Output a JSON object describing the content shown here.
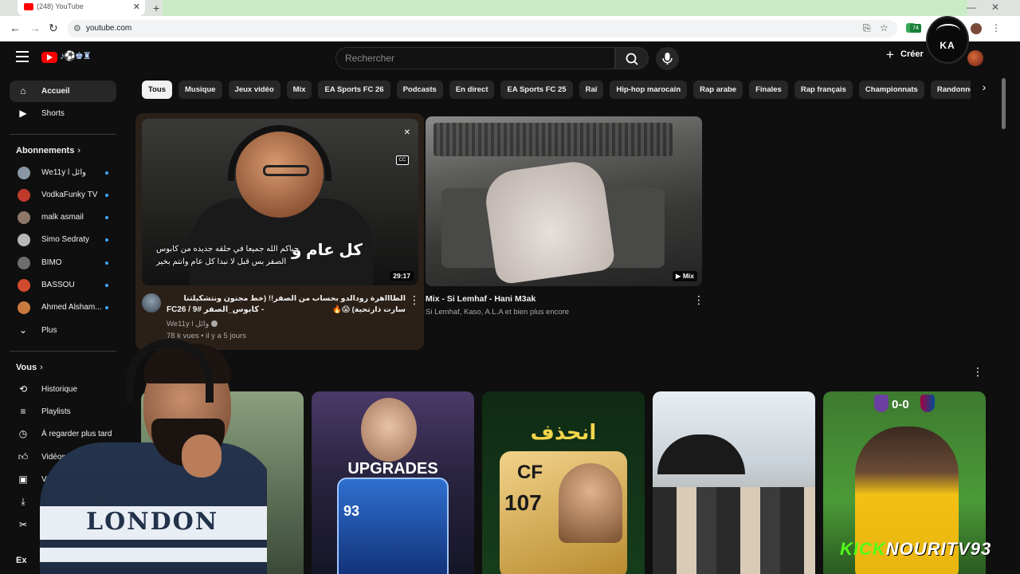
{
  "browser": {
    "tab_title": "(248) YouTube",
    "url": "youtube.com",
    "extension_badge": "74"
  },
  "header": {
    "search_placeholder": "Rechercher",
    "create_label": "Créer",
    "channel_badge_text": "KA"
  },
  "sidebar": {
    "main": [
      {
        "label": "Accueil",
        "icon": "home-icon",
        "active": true
      },
      {
        "label": "Shorts",
        "icon": "shorts-icon",
        "active": false
      }
    ],
    "subscriptions_heading": "Abonnements",
    "subscriptions": [
      {
        "label": "We11y l وائل",
        "avatar_color": "#8a96a3"
      },
      {
        "label": "VodkaFunky TV",
        "avatar_color": "#c0392b"
      },
      {
        "label": "malk asmail",
        "avatar_color": "#8e7766"
      },
      {
        "label": "Simo Sedraty",
        "avatar_color": "#b7b7b7"
      },
      {
        "label": "BIMO",
        "avatar_color": "#6d6d6d"
      },
      {
        "label": "BASSOU",
        "avatar_color": "#d24a2d"
      },
      {
        "label": "Ahmed Alsham...",
        "avatar_color": "#c87a3e"
      }
    ],
    "more_label": "Plus",
    "you_heading": "Vous",
    "you_items": [
      {
        "label": "Historique",
        "icon": "history-icon"
      },
      {
        "label": "Playlists",
        "icon": "playlists-icon"
      },
      {
        "label": "À regarder plus tard",
        "icon": "watch-later-icon"
      },
      {
        "label": "Vidéos \"J'",
        "icon": "liked-icon"
      },
      {
        "label": "Vos vid",
        "icon": "your-videos-icon"
      },
      {
        "label": "Té",
        "icon": "downloads-icon"
      },
      {
        "label": "E",
        "icon": "clips-icon"
      }
    ],
    "explore_heading": "Ex"
  },
  "chips": [
    "Tous",
    "Musique",
    "Jeux vidéo",
    "Mix",
    "EA Sports FC 26",
    "Podcasts",
    "En direct",
    "EA Sports FC 25",
    "Raï",
    "Hip-hop marocain",
    "Rap arabe",
    "Finales",
    "Rap français",
    "Championnats",
    "Randonnées pédestres"
  ],
  "videos": [
    {
      "title_line1": "الطاااهرة رودالدو بحساب من الصفر!! (خط مجنون ونتشكيلتنا سارت ذارتحية) 😱🔥",
      "title_line2": "FC26 / 9# كابوس_الصفر -",
      "channel": "We11y l وائل",
      "meta": "78 k vues • il y a 5 jours",
      "duration": "29:17",
      "subtitle_line1": "حياكم الله جميعا في حلقه جديده من كابوس",
      "subtitle_line2": "الصفر بس قبل لا نبدا كل عام وانتم بخير",
      "overlay_big": "كل عام و",
      "cc_label": "CC"
    },
    {
      "title": "Mix - Si Lemhaf - Hani M3ak",
      "subtitle": "Si Lemhaf, Kaso, A.L.A et bien plus encore",
      "badge": "Mix"
    }
  ],
  "shorts": [
    {
      "overlay": ""
    },
    {
      "overlay": "UPGRADES",
      "rating": "93"
    },
    {
      "overlay": "انحذف",
      "position": "CF",
      "rating": "107"
    },
    {
      "overlay": ""
    },
    {
      "overlay": "0-0"
    }
  ],
  "webcam": {
    "shirt_text": "LONDON"
  },
  "watermark": {
    "kick": "KICK",
    "name": "NOURITV93"
  }
}
